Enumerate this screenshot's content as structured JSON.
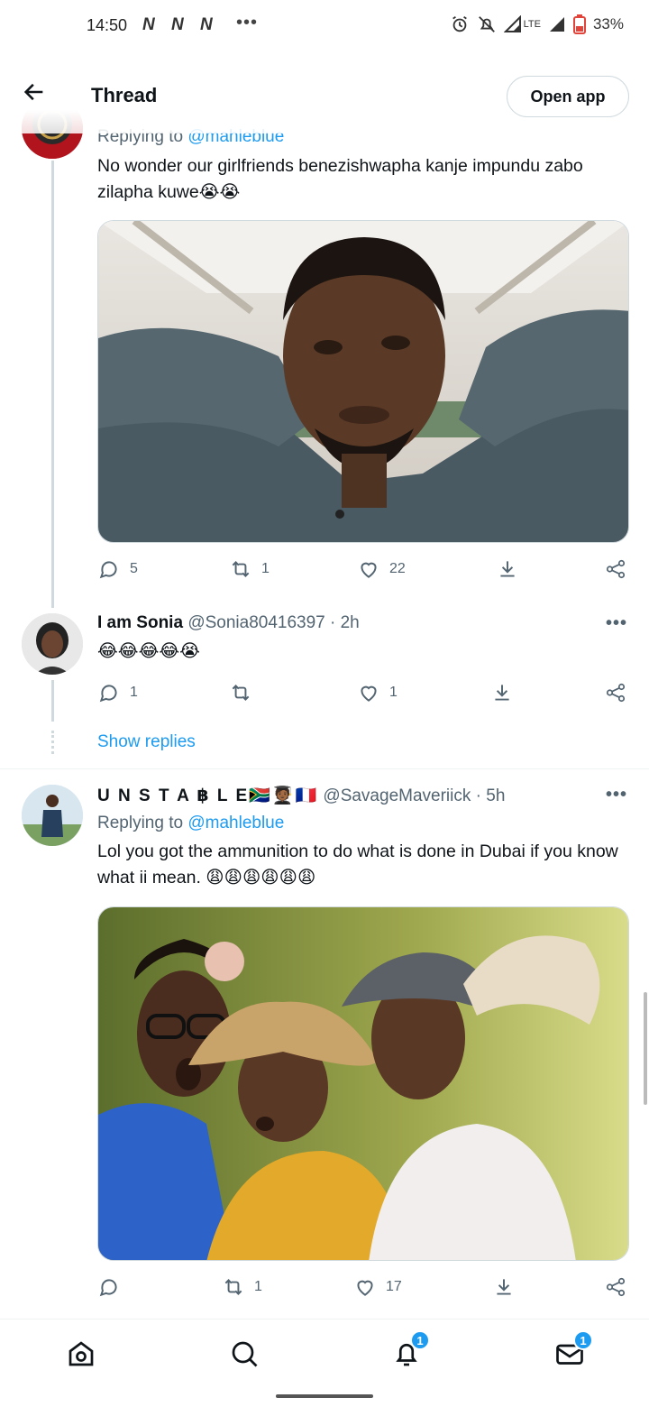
{
  "status_bar": {
    "time": "14:50",
    "carrier_icons": [
      "N",
      "N",
      "N"
    ],
    "more_dots": "•••",
    "lte": "LTE",
    "battery": "33%"
  },
  "header": {
    "title": "Thread",
    "open_app": "Open app"
  },
  "tweets": [
    {
      "replying_prefix": "Replying to ",
      "replying_handle": "@mahleblue",
      "text": "No wonder our girlfriends benezishwapha kanje impundu zabo zilapha kuwe😭😭",
      "actions": {
        "replies": "5",
        "retweets": "1",
        "likes": "22"
      }
    },
    {
      "display_name": "I am Sonia",
      "handle_time": "@Sonia80416397 · 2h",
      "text": "😂😂😂😂😭",
      "actions": {
        "replies": "1",
        "retweets": "",
        "likes": "1"
      }
    },
    {
      "display_name": "U N S T A ฿ L E🇿🇦🧑🏾‍🎓🇫🇷",
      "handle_time": "@SavageMaveriick · 5h",
      "replying_prefix": "Replying to ",
      "replying_handle": "@mahleblue",
      "text": "Lol you got the ammunition to do what is done in Dubai if you know what ii mean. 😩😩😩😩😩😩",
      "actions": {
        "replies": "",
        "retweets": "1",
        "likes": "17"
      }
    }
  ],
  "show_replies": "Show replies",
  "more_label": "•••",
  "bottom_nav": {
    "notifications_badge": "1",
    "messages_badge": "1"
  },
  "colors": {
    "accent": "#1d9bf0",
    "text": "#0f1419",
    "secondary": "#536471",
    "border": "#cfd9de"
  },
  "icons": [
    "back-arrow-icon",
    "reply-icon",
    "retweet-icon",
    "like-icon",
    "download-icon",
    "share-icon",
    "home-icon",
    "search-icon",
    "bell-icon",
    "mail-icon"
  ]
}
